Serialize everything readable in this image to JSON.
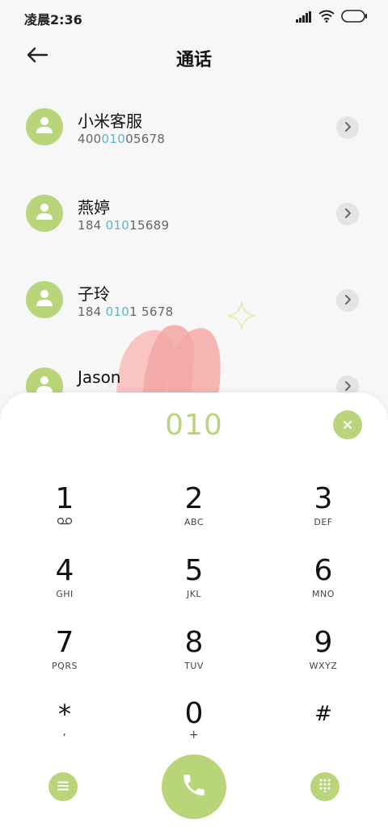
{
  "status_bar": {
    "time": "凌晨2:36",
    "icons": [
      "signal-icon",
      "wifi-icon",
      "battery-icon"
    ]
  },
  "header": {
    "title": "通话",
    "back_icon": "back-arrow-icon"
  },
  "contacts": [
    {
      "name": "小米客服",
      "number_parts": [
        "400",
        "010",
        "05678"
      ]
    },
    {
      "name": "燕婷",
      "number_parts": [
        "184 ",
        "010",
        "15689"
      ]
    },
    {
      "name": "子玲",
      "number_parts": [
        "184 ",
        "010",
        "1 5678"
      ]
    },
    {
      "name": "Jason",
      "number_parts": [
        "",
        "",
        ""
      ]
    }
  ],
  "dialer": {
    "typed_number": "010",
    "clear_icon": "close-icon",
    "keys": [
      {
        "digit": "1",
        "letters": "",
        "sub_icon": "voicemail-icon"
      },
      {
        "digit": "2",
        "letters": "ABC"
      },
      {
        "digit": "3",
        "letters": "DEF"
      },
      {
        "digit": "4",
        "letters": "GHI"
      },
      {
        "digit": "5",
        "letters": "JKL"
      },
      {
        "digit": "6",
        "letters": "MNO"
      },
      {
        "digit": "7",
        "letters": "PQRS"
      },
      {
        "digit": "8",
        "letters": "TUV"
      },
      {
        "digit": "9",
        "letters": "WXYZ"
      },
      {
        "digit": "*",
        "letters": ","
      },
      {
        "digit": "0",
        "letters": "+"
      },
      {
        "digit": "#",
        "letters": ""
      }
    ],
    "bottom_buttons": [
      "menu-icon",
      "phone-icon",
      "keypad-icon"
    ]
  },
  "colors": {
    "accent": "#b9d57a",
    "highlight": "#5cb6c4",
    "background": "#f7f7f7"
  }
}
